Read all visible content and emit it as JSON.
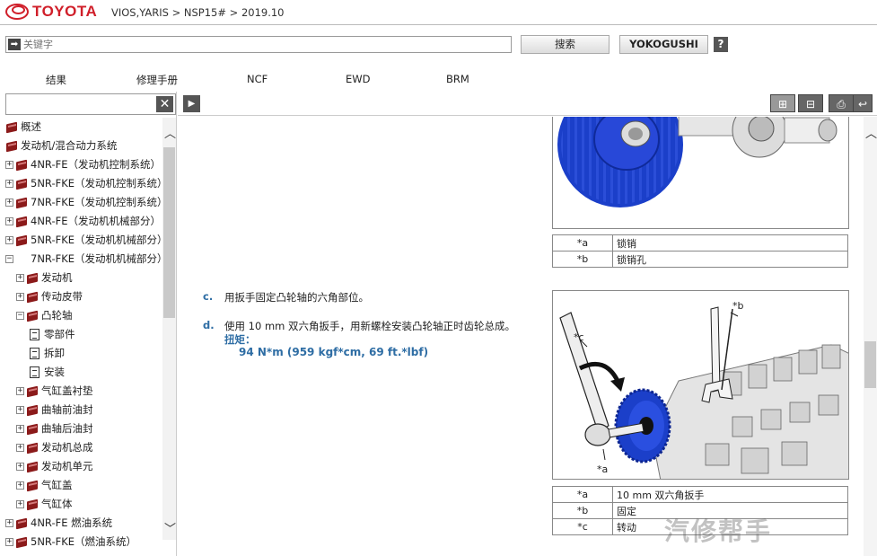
{
  "header": {
    "brand": "TOYOTA",
    "breadcrumb": "VIOS,YARIS > NSP15# > 2019.10"
  },
  "search": {
    "placeholder": "关键字",
    "search_label": "搜索",
    "yoko_label": "YOKOGUSHI",
    "help_label": "?"
  },
  "tabs": [
    "结果",
    "修理手册",
    "NCF",
    "EWD",
    "BRM"
  ],
  "tree": {
    "clear_label": "✕",
    "items": [
      {
        "label": "概述",
        "icon": "book",
        "level": 0,
        "expander": ""
      },
      {
        "label": "发动机/混合动力系统",
        "icon": "book",
        "level": 0,
        "expander": ""
      },
      {
        "label": "4NR-FE（发动机控制系统）",
        "icon": "book",
        "level": 1,
        "expander": "+"
      },
      {
        "label": "5NR-FKE（发动机控制系统）",
        "icon": "book",
        "level": 1,
        "expander": "+"
      },
      {
        "label": "7NR-FKE（发动机控制系统）",
        "icon": "book",
        "level": 1,
        "expander": "+"
      },
      {
        "label": "4NR-FE（发动机机械部分）",
        "icon": "book",
        "level": 1,
        "expander": "+"
      },
      {
        "label": "5NR-FKE（发动机机械部分）",
        "icon": "book",
        "level": 1,
        "expander": "+"
      },
      {
        "label": "7NR-FKE（发动机机械部分）",
        "icon": "none",
        "level": 1,
        "expander": "−"
      },
      {
        "label": "发动机",
        "icon": "book",
        "level": 2,
        "expander": "+"
      },
      {
        "label": "传动皮带",
        "icon": "book",
        "level": 2,
        "expander": "+"
      },
      {
        "label": "凸轮轴",
        "icon": "book",
        "level": 2,
        "expander": "−"
      },
      {
        "label": "零部件",
        "icon": "doc",
        "level": 3,
        "expander": ""
      },
      {
        "label": "拆卸",
        "icon": "doc",
        "level": 3,
        "expander": ""
      },
      {
        "label": "安装",
        "icon": "doc",
        "level": 3,
        "expander": ""
      },
      {
        "label": "气缸盖衬垫",
        "icon": "book",
        "level": 2,
        "expander": "+"
      },
      {
        "label": "曲轴前油封",
        "icon": "book",
        "level": 2,
        "expander": "+"
      },
      {
        "label": "曲轴后油封",
        "icon": "book",
        "level": 2,
        "expander": "+"
      },
      {
        "label": "发动机总成",
        "icon": "book",
        "level": 2,
        "expander": "+"
      },
      {
        "label": "发动机单元",
        "icon": "book",
        "level": 2,
        "expander": "+"
      },
      {
        "label": "气缸盖",
        "icon": "book",
        "level": 2,
        "expander": "+"
      },
      {
        "label": "气缸体",
        "icon": "book",
        "level": 2,
        "expander": "+"
      },
      {
        "label": "4NR-FE 燃油系统",
        "icon": "book",
        "level": 1,
        "expander": "+"
      },
      {
        "label": "5NR-FKE（燃油系统）",
        "icon": "book",
        "level": 1,
        "expander": "+"
      }
    ]
  },
  "content": {
    "legend1": [
      {
        "key": "*a",
        "value": "锁销"
      },
      {
        "key": "*b",
        "value": "锁销孔"
      }
    ],
    "step_c": {
      "letter": "c.",
      "text": "用扳手固定凸轮轴的六角部位。"
    },
    "step_d": {
      "letter": "d.",
      "text": "使用 10 mm 双六角扳手，用新螺栓安装凸轮轴正时齿轮总成。",
      "torque_label": "扭矩：",
      "torque_value": "94 N*m (959 kgf*cm, 69 ft.*lbf)"
    },
    "fig2_callouts": {
      "a": "*a",
      "b": "*b",
      "c": "*c"
    },
    "legend2": [
      {
        "key": "*a",
        "value": "10 mm 双六角扳手"
      },
      {
        "key": "*b",
        "value": "固定"
      },
      {
        "key": "*c",
        "value": "转动"
      }
    ]
  },
  "watermark": "汽修帮手",
  "colors": {
    "brand": "#d01f2a",
    "accent_blue": "#2e6da4",
    "gear_blue": "#1b3fc9"
  }
}
